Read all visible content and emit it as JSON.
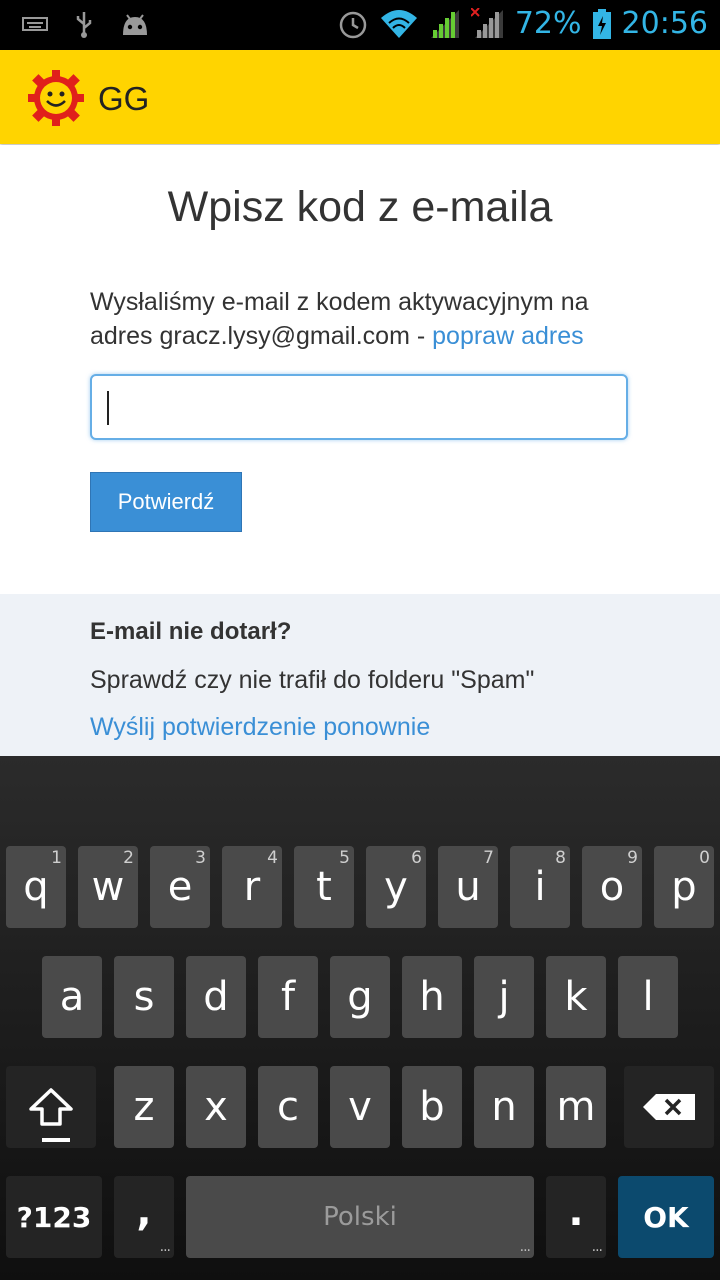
{
  "status_bar": {
    "battery": "72%",
    "time": "20:56",
    "icons": [
      "keyboard-icon",
      "usb-icon",
      "android-icon",
      "alarm-icon",
      "wifi-icon",
      "signal-icon",
      "signal-no-data-icon",
      "battery-charging-icon"
    ]
  },
  "app_bar": {
    "title": "GG",
    "logo": "gg-sun-logo"
  },
  "main": {
    "heading": "Wpisz kod z e-maila",
    "desc_text": "Wysłaliśmy e-mail z kodem aktywacyjnym na adres gracz.lysy@gmail.com - ",
    "desc_link": "popraw adres",
    "code_input_value": "",
    "confirm_label": "Potwierdź"
  },
  "help": {
    "title": "E-mail nie dotarł?",
    "text": "Sprawdź czy nie trafił do folderu \"Spam\"",
    "resend_link": "Wyślij potwierdzenie ponownie"
  },
  "keyboard": {
    "row1": [
      {
        "k": "q",
        "h": "1"
      },
      {
        "k": "w",
        "h": "2"
      },
      {
        "k": "e",
        "h": "3"
      },
      {
        "k": "r",
        "h": "4"
      },
      {
        "k": "t",
        "h": "5"
      },
      {
        "k": "y",
        "h": "6"
      },
      {
        "k": "u",
        "h": "7"
      },
      {
        "k": "i",
        "h": "8"
      },
      {
        "k": "o",
        "h": "9"
      },
      {
        "k": "p",
        "h": "0"
      }
    ],
    "row2": [
      "a",
      "s",
      "d",
      "f",
      "g",
      "h",
      "j",
      "k",
      "l"
    ],
    "row3": [
      "z",
      "x",
      "c",
      "v",
      "b",
      "n",
      "m"
    ],
    "sym_label": "?123",
    "comma": ",",
    "space_label": "Polski",
    "period": ".",
    "ok_label": "OK",
    "colors": {
      "key": "#4a4a4a",
      "ok": "#0c4a6e",
      "accent": "#3a8fd6",
      "appbar": "#ffd400"
    }
  }
}
